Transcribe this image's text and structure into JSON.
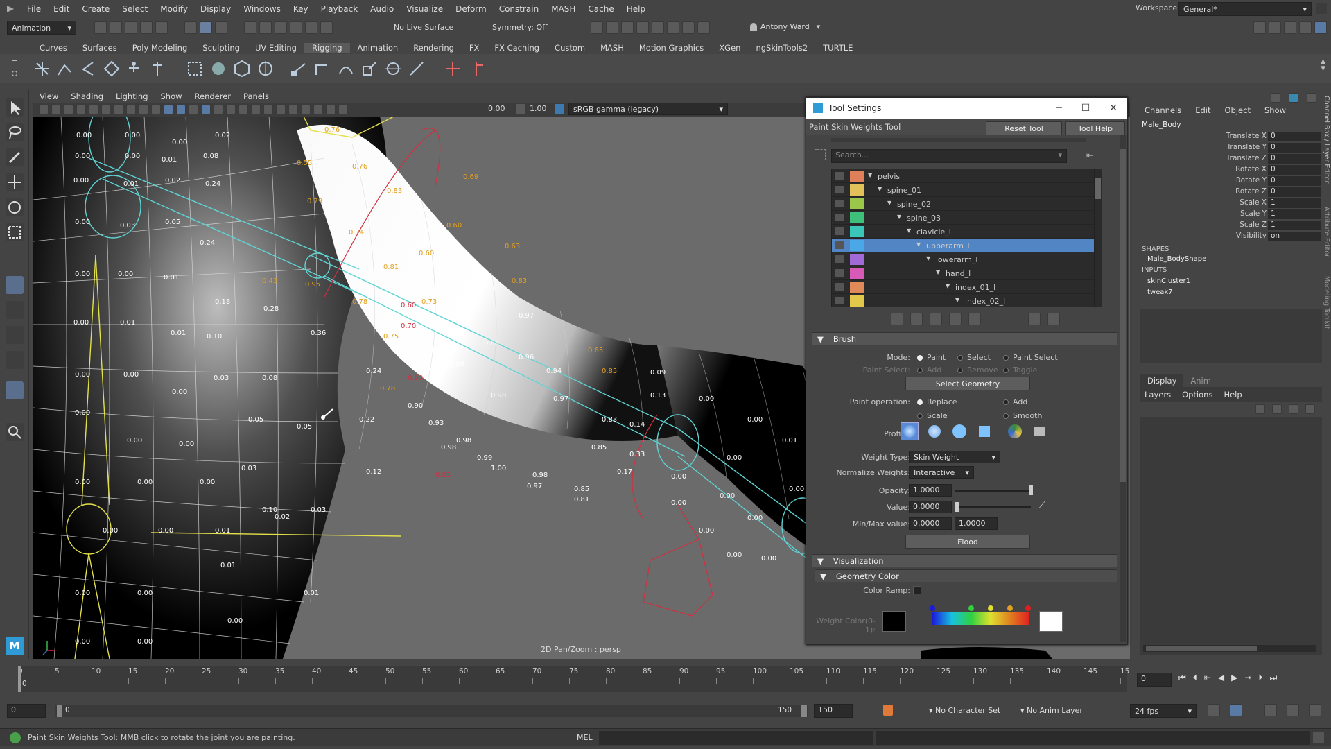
{
  "menubar": {
    "items": [
      "File",
      "Edit",
      "Create",
      "Select",
      "Modify",
      "Display",
      "Windows",
      "Key",
      "Playback",
      "Audio",
      "Visualize",
      "Deform",
      "Constrain",
      "MASH",
      "Cache",
      "Help"
    ],
    "workspace_label": "Workspace:",
    "workspace_value": "General*"
  },
  "statusline": {
    "mode": "Animation",
    "live_surface": "No Live Surface",
    "symmetry": "Symmetry: Off",
    "user": "Antony Ward"
  },
  "shelf_tabs": [
    "Curves",
    "Surfaces",
    "Poly Modeling",
    "Sculpting",
    "UV Editing",
    "Rigging",
    "Animation",
    "Rendering",
    "FX",
    "FX Caching",
    "Custom",
    "MASH",
    "Motion Graphics",
    "XGen",
    "ngSkinTools2",
    "TURTLE"
  ],
  "panel_menu": [
    "View",
    "Shading",
    "Lighting",
    "Show",
    "Renderer",
    "Panels"
  ],
  "panel_tools": {
    "exposure": "0.00",
    "gamma": "1.00",
    "color_space": "sRGB gamma (legacy)"
  },
  "viewport": {
    "label": "2D Pan/Zoom : persp"
  },
  "tool_settings": {
    "window_title": "Tool Settings",
    "tool_name": "Paint Skin Weights Tool",
    "reset_button": "Reset Tool",
    "help_button": "Tool Help",
    "search_placeholder": "Search...",
    "joints": [
      {
        "name": "pelvis",
        "color": "#e0805a",
        "indent": 0
      },
      {
        "name": "spine_01",
        "color": "#e2c05a",
        "indent": 1
      },
      {
        "name": "spine_02",
        "color": "#9ac64a",
        "indent": 2
      },
      {
        "name": "spine_03",
        "color": "#3fc07a",
        "indent": 3
      },
      {
        "name": "clavicle_l",
        "color": "#3ac6b8",
        "indent": 4
      },
      {
        "name": "upperarm_l",
        "color": "#4aa8e6",
        "indent": 5
      },
      {
        "name": "lowerarm_l",
        "color": "#a26ad6",
        "indent": 6
      },
      {
        "name": "hand_l",
        "color": "#d65ab6",
        "indent": 7
      },
      {
        "name": "index_01_l",
        "color": "#e08a5a",
        "indent": 8
      },
      {
        "name": "index_02_l",
        "color": "#e2c84a",
        "indent": 9
      }
    ],
    "brush": {
      "section": "Brush",
      "mode_label": "Mode:",
      "mode_options": [
        "Paint",
        "Select",
        "Paint Select"
      ],
      "paint_select_label": "Paint Select:",
      "paint_select_options": [
        "Add",
        "Remove",
        "Toggle"
      ],
      "select_geometry": "Select Geometry",
      "paint_op_label": "Paint operation:",
      "paint_ops": [
        "Replace",
        "Add",
        "Scale",
        "Smooth"
      ],
      "profile_label": "Profile:",
      "weight_type_label": "Weight Type:",
      "weight_type": "Skin Weight",
      "normalize_label": "Normalize Weights:",
      "normalize": "Interactive",
      "opacity_label": "Opacity:",
      "opacity": "1.0000",
      "value_label": "Value:",
      "value": "0.0000",
      "minmax_label": "Min/Max value:",
      "min": "0.0000",
      "max": "1.0000",
      "flood": "Flood"
    },
    "visualization": {
      "section": "Visualization",
      "geometry_color": "Geometry Color",
      "color_ramp_label": "Color Ramp:",
      "weight_color_label": "Weight Color(0-1):"
    }
  },
  "channel_box": {
    "menu": [
      "Channels",
      "Edit",
      "Object",
      "Show"
    ],
    "object": "Male_Body",
    "channels": [
      {
        "name": "Translate X",
        "value": "0"
      },
      {
        "name": "Translate Y",
        "value": "0"
      },
      {
        "name": "Translate Z",
        "value": "0"
      },
      {
        "name": "Rotate X",
        "value": "0"
      },
      {
        "name": "Rotate Y",
        "value": "0"
      },
      {
        "name": "Rotate Z",
        "value": "0"
      },
      {
        "name": "Scale X",
        "value": "1"
      },
      {
        "name": "Scale Y",
        "value": "1"
      },
      {
        "name": "Scale Z",
        "value": "1"
      },
      {
        "name": "Visibility",
        "value": "on"
      }
    ],
    "shapes_header": "SHAPES",
    "shape": "Male_BodyShape",
    "inputs_header": "INPUTS",
    "inputs": [
      "skinCluster1",
      "tweak7"
    ],
    "side_tabs": [
      "Channel Box / Layer Editor",
      "Attribute Editor",
      "Modeling Toolkit"
    ]
  },
  "layer_editor": {
    "tabs": [
      "Display",
      "Anim"
    ],
    "menu": [
      "Layers",
      "Options",
      "Help"
    ]
  },
  "timeline": {
    "ticks": [
      "0",
      "5",
      "10",
      "15",
      "20",
      "25",
      "30",
      "35",
      "40",
      "45",
      "50",
      "55",
      "60",
      "65",
      "70",
      "75",
      "80",
      "85",
      "90",
      "95",
      "100",
      "105",
      "110",
      "115",
      "120",
      "125",
      "130",
      "135",
      "140",
      "145",
      "15"
    ],
    "current_frame": "0",
    "current_frame_field": "0"
  },
  "range": {
    "start": "0",
    "start_inner": "0",
    "end_inner": "150",
    "end": "150",
    "character_set": "No Character Set",
    "anim_layer": "No Anim Layer",
    "fps": "24 fps"
  },
  "helpline": {
    "message": "Paint Skin Weights Tool: MMB click to rotate the joint you are painting.",
    "mel": "MEL"
  },
  "colors": {
    "selection": "#5285c4",
    "panel_bg": "#444444"
  }
}
